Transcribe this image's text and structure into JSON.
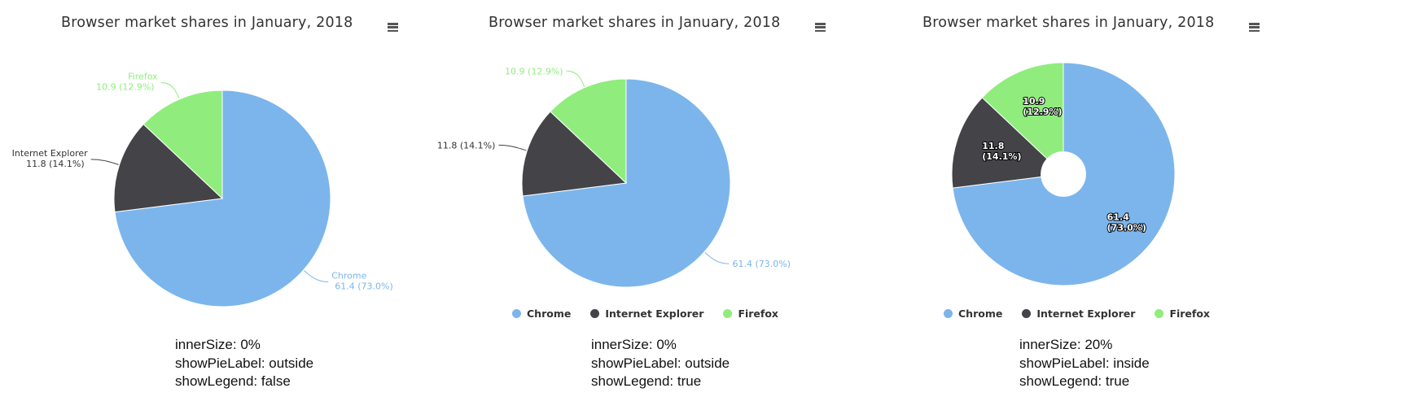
{
  "chart_data": [
    {
      "type": "pie",
      "title": "Browser market shares in January, 2018",
      "categories": [
        "Chrome",
        "Internet Explorer",
        "Firefox"
      ],
      "values": [
        61.4,
        11.8,
        10.9
      ],
      "percent_labels": [
        "73.0%",
        "14.1%",
        "12.9%"
      ],
      "colors": [
        "#7cb5ec",
        "#434348",
        "#90ed7d"
      ],
      "inner_size": "0%",
      "label_position": "outside",
      "show_names_in_labels": true,
      "legend": null,
      "caption": [
        "innerSize: 0%",
        "showPieLabel: outside",
        "showLegend: false"
      ]
    },
    {
      "type": "pie",
      "title": "Browser market shares in January, 2018",
      "categories": [
        "Chrome",
        "Internet Explorer",
        "Firefox"
      ],
      "values": [
        61.4,
        11.8,
        10.9
      ],
      "percent_labels": [
        "73.0%",
        "14.1%",
        "12.9%"
      ],
      "colors": [
        "#7cb5ec",
        "#434348",
        "#90ed7d"
      ],
      "inner_size": "0%",
      "label_position": "outside",
      "show_names_in_labels": false,
      "legend": "bottom",
      "caption": [
        "innerSize: 0%",
        "showPieLabel: outside",
        "showLegend: true"
      ]
    },
    {
      "type": "pie",
      "title": "Browser market shares in January, 2018",
      "categories": [
        "Chrome",
        "Internet Explorer",
        "Firefox"
      ],
      "values": [
        61.4,
        11.8,
        10.9
      ],
      "percent_labels": [
        "73.0%",
        "14.1%",
        "12.9%"
      ],
      "colors": [
        "#7cb5ec",
        "#434348",
        "#90ed7d"
      ],
      "inner_size": "20%",
      "label_position": "inside",
      "show_names_in_labels": false,
      "legend": "bottom",
      "caption": [
        "innerSize: 20%",
        "showPieLabel: inside",
        "showLegend: true"
      ]
    }
  ]
}
